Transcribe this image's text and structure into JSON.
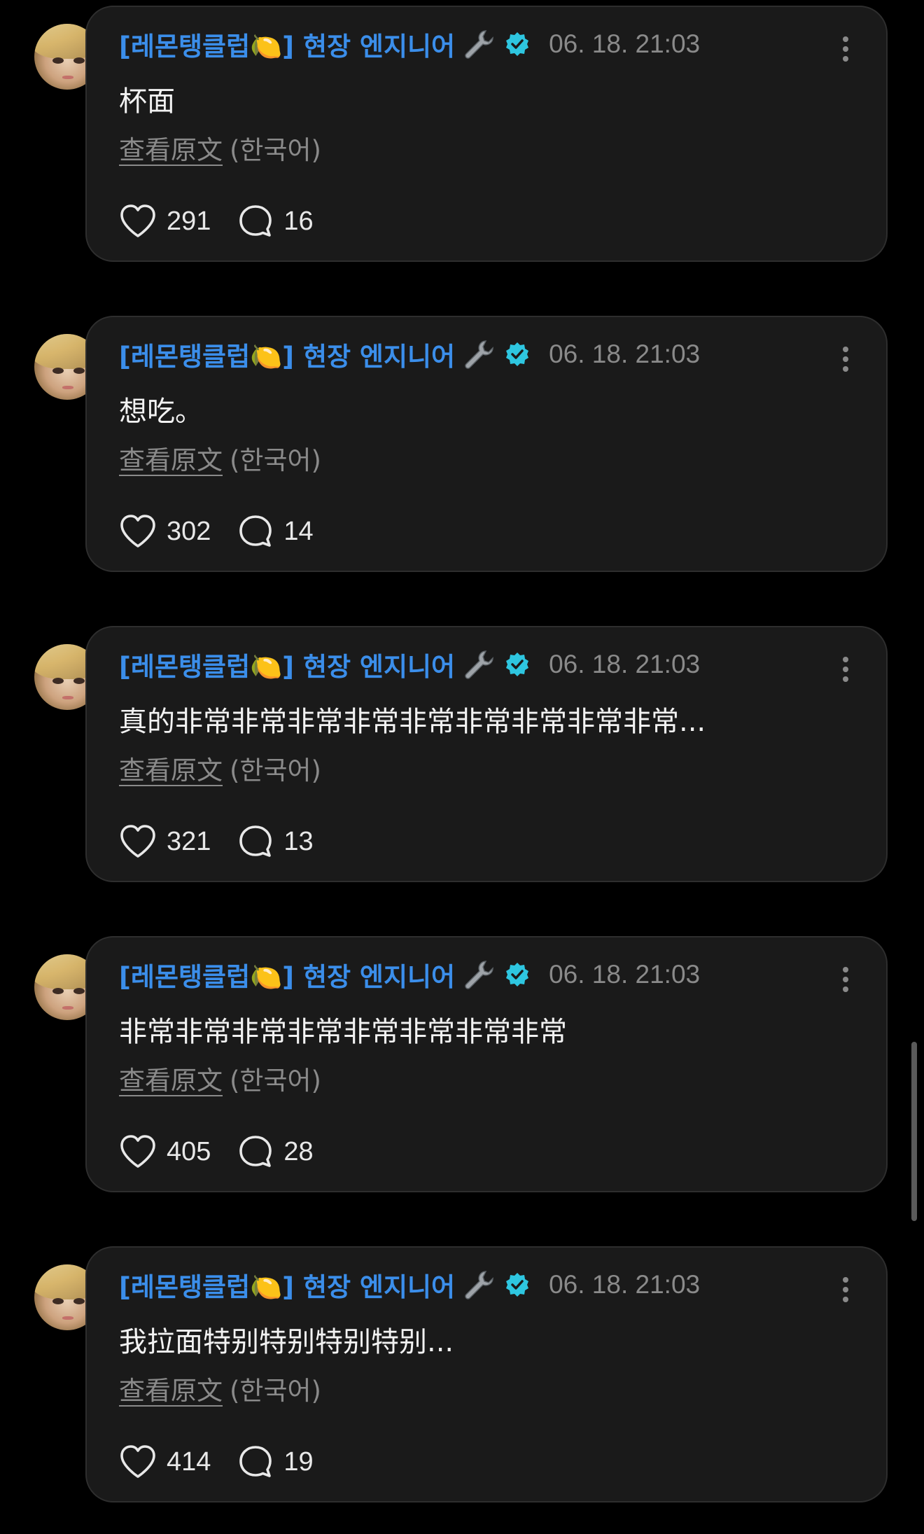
{
  "author": "[레몬탱클럽🍋] 현장 엔지니어",
  "translate_link": "查看原文",
  "translate_lang": "(한국어)",
  "icons": {
    "wrench": "wrench-icon",
    "verified": "verified-badge-icon",
    "more": "more-options-icon",
    "like": "heart-icon",
    "comment": "comment-icon"
  },
  "colors": {
    "author": "#3b8eea",
    "verified": "#2ec6e0",
    "background": "#000000",
    "card": "#1a1a1a"
  },
  "posts": [
    {
      "time": "06. 18. 21:03",
      "text": "杯面",
      "likes": "291",
      "comments": "16"
    },
    {
      "time": "06. 18. 21:03",
      "text": "想吃。",
      "likes": "302",
      "comments": "14"
    },
    {
      "time": "06. 18. 21:03",
      "text": "真的非常非常非常非常非常非常非常非常非常...",
      "likes": "321",
      "comments": "13"
    },
    {
      "time": "06. 18. 21:03",
      "text": "非常非常非常非常非常非常非常非常",
      "likes": "405",
      "comments": "28"
    },
    {
      "time": "06. 18. 21:03",
      "text": "我拉面特别特别特别特别...",
      "likes": "414",
      "comments": "19"
    }
  ]
}
